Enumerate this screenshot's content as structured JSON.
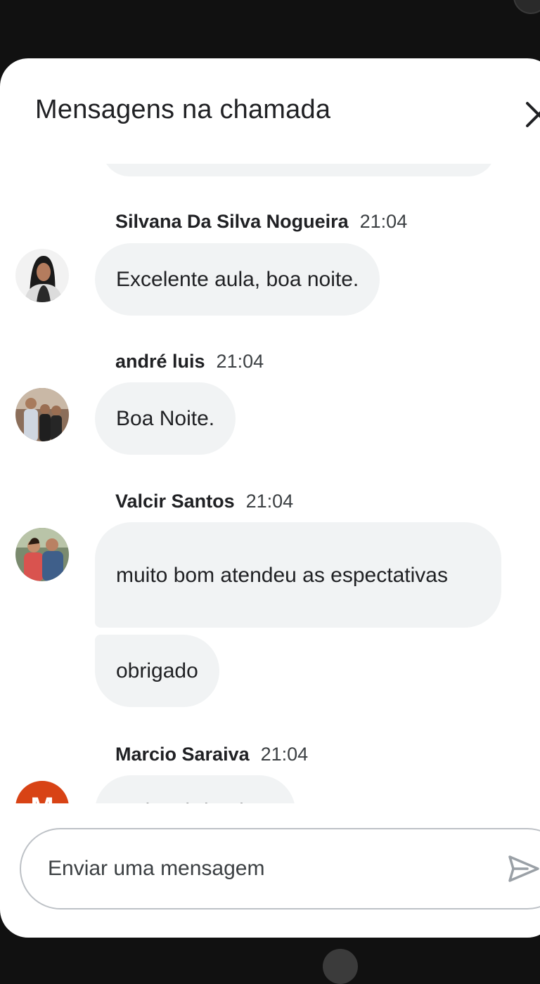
{
  "dialog": {
    "title": "Mensagens na chamada",
    "close_icon": "close-icon"
  },
  "messages": [
    {
      "sender": "Silvana Da Silva Nogueira",
      "time": "21:04",
      "avatar": "photo-woman",
      "bubbles": [
        "Excelente aula, boa noite."
      ]
    },
    {
      "sender": "andré luis",
      "time": "21:04",
      "avatar": "photo-group",
      "bubbles": [
        "Boa Noite."
      ]
    },
    {
      "sender": "Valcir Santos",
      "time": "21:04",
      "avatar": "photo-couple",
      "bubbles": [
        "muito bom atendeu as espectativas",
        "obrigado"
      ]
    },
    {
      "sender": "Marcio Saraiva",
      "time": "21:04",
      "avatar": "letter-avatar",
      "avatar_letter": "M",
      "avatar_color": "#d84315",
      "bubbles": [
        "Muito obrigado"
      ]
    }
  ],
  "composer": {
    "placeholder": "Enviar uma mensagem",
    "send_icon": "send-icon"
  },
  "colors": {
    "bubble": "#f1f3f4",
    "text": "#202124",
    "backdrop": "#111111"
  }
}
